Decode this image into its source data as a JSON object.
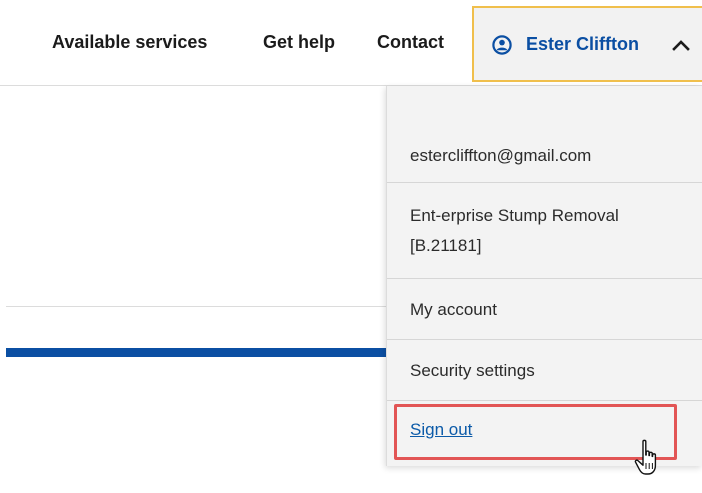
{
  "nav": {
    "links": [
      {
        "label": "Available services"
      },
      {
        "label": "Get help"
      },
      {
        "label": "Contact"
      }
    ],
    "user": {
      "name": "Ester Cliffton",
      "icon": "user-circle-icon",
      "chevron": "chevron-up-icon"
    }
  },
  "dropdown": {
    "email": "estercliffton@gmail.com",
    "organization_line1": "Ent-erprise Stump Removal",
    "organization_line2": "[B.21181]",
    "items": [
      {
        "label": "My account"
      },
      {
        "label": "Security settings"
      },
      {
        "label": "Sign out"
      }
    ]
  },
  "colors": {
    "brand_blue": "#0b4fa3",
    "trigger_border": "#f0bf4c",
    "highlight": "#e25555",
    "dropdown_bg": "#f3f3f3"
  }
}
